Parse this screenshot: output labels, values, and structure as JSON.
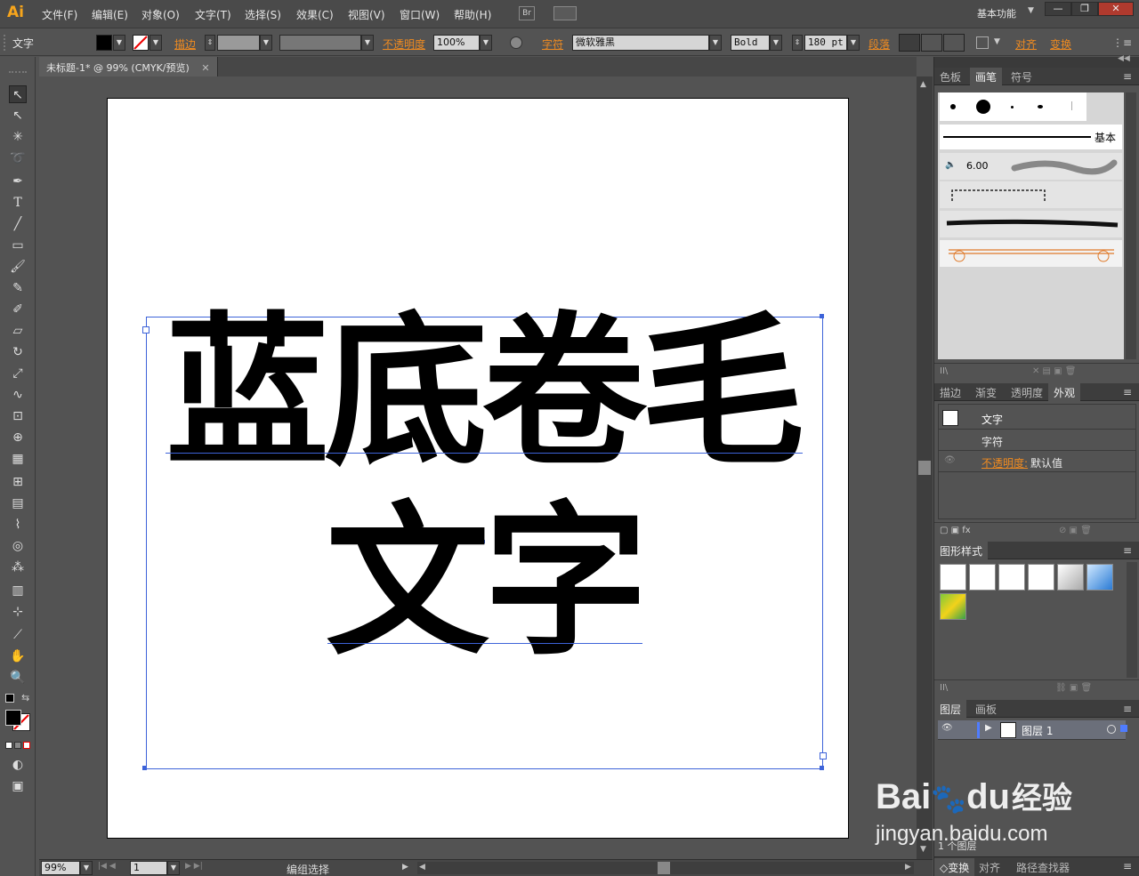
{
  "app": {
    "logo": "Ai",
    "workspace": "基本功能",
    "br_label": "Br"
  },
  "menu": [
    "文件(F)",
    "编辑(E)",
    "对象(O)",
    "文字(T)",
    "选择(S)",
    "效果(C)",
    "视图(V)",
    "窗口(W)",
    "帮助(H)"
  ],
  "window_buttons": [
    "—",
    "❐",
    "✕"
  ],
  "control": {
    "tool_label": "文字",
    "stroke_label": "描边",
    "opacity_label": "不透明度",
    "opacity_value": "100%",
    "char_label": "字符",
    "font": "微软雅黑",
    "weight": "Bold",
    "size": "180 pt",
    "para_label": "段落",
    "align_label": "对齐",
    "transform_label": "变换"
  },
  "document": {
    "tab_title": "未标题-1* @ 99% (CMYK/预览)",
    "close": "✕"
  },
  "artboard_text": {
    "line1": "蓝底卷毛",
    "line2": "文字"
  },
  "brushes": {
    "tabs": [
      "色板",
      "画笔",
      "符号"
    ],
    "basic_label": "基本",
    "size_label": "6.00"
  },
  "appearance": {
    "tabs": [
      "描边",
      "渐变",
      "透明度",
      "外观"
    ],
    "title": "文字",
    "sub": "字符",
    "opacity_label": "不透明度:",
    "opacity_value": "默认值"
  },
  "graphic_styles": {
    "title": "图形样式"
  },
  "layers": {
    "tabs": [
      "图层",
      "画板"
    ],
    "layer_name": "图层 1",
    "count": "1 个图层"
  },
  "status": {
    "zoom": "99%",
    "page": "1",
    "mode": "编组选择"
  },
  "bottom_tabs": [
    "◇变换",
    "对齐",
    "路径查找器"
  ],
  "watermark": {
    "brand": "Bai",
    "brand2": "du",
    "brand_cn": "经验",
    "url": "jingyan.baidu.com"
  },
  "colors": {
    "accent": "#f08b20",
    "selection": "#3d63d9"
  }
}
